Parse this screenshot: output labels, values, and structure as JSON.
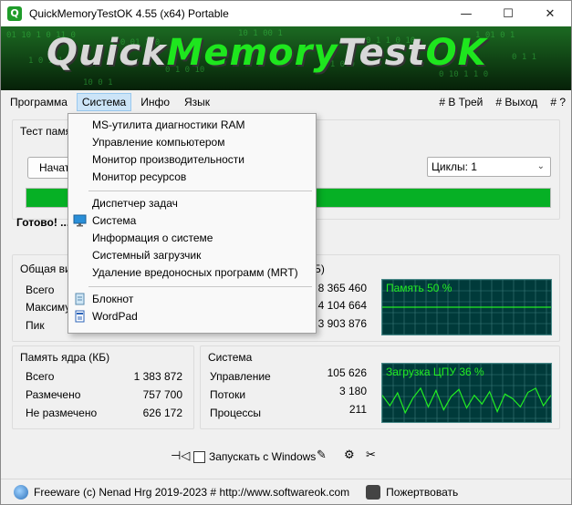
{
  "window": {
    "title": "QuickMemoryTestOK 4.55  (x64) Portable",
    "app_icon_letter": "Q",
    "minimize": "—",
    "maximize": "☐",
    "close": "✕"
  },
  "banner": {
    "part1": "Quick",
    "part2": "Memory",
    "part3": "Test",
    "part4": "OK"
  },
  "menubar": {
    "items": [
      "Программа",
      "Система",
      "Инфо",
      "Язык"
    ],
    "right": [
      "# В Трей",
      "# Выход",
      "# ?"
    ]
  },
  "test_group": {
    "title": "Тест памя",
    "start_button": "Начат",
    "cycles": "Циклы: 1",
    "progress": 1.0,
    "status": "Готово! ..."
  },
  "overall_group": {
    "title": "Общая ви",
    "title_suffix": "Б)",
    "rows": [
      {
        "label": "Всего",
        "value": "8 365 460"
      },
      {
        "label": "Максимум",
        "value": "4 104 664"
      },
      {
        "label": "Пик",
        "value": "3 903 876"
      }
    ],
    "graph_label": "Память 50 %",
    "graph_percent": 50
  },
  "kernel_group": {
    "title": "Память ядра (КБ)",
    "rows": [
      {
        "label": "Всего",
        "value": "1 383 872"
      },
      {
        "label": "Размечено",
        "value": "757 700"
      },
      {
        "label": "Не размечено",
        "value": "626 172"
      }
    ]
  },
  "system_group": {
    "title": "Система",
    "rows": [
      {
        "label": "Управление",
        "value": "105 626"
      },
      {
        "label": "Потоки",
        "value": "3 180"
      },
      {
        "label": "Процессы",
        "value": "211"
      }
    ],
    "graph_label": "Загрузка ЦПУ 36 %",
    "graph_percent": 36
  },
  "autostart": {
    "label": "Запускать с Windows",
    "checked": false
  },
  "footer": {
    "text": "Freeware (c) Nenad Hrg 2019-2023 # http://www.softwareok.com",
    "donate": "Пожертвовать"
  },
  "dropdown": {
    "items": [
      {
        "label": "MS-утилита диагностики RAM",
        "icon": ""
      },
      {
        "label": "Управление компьютером",
        "icon": ""
      },
      {
        "label": "Монитор производительности",
        "icon": ""
      },
      {
        "label": "Монитор ресурсов",
        "icon": ""
      },
      {
        "label": "Диспетчер задач",
        "icon": ""
      },
      {
        "label": "Система",
        "icon": "monitor-icon"
      },
      {
        "label": "Информация о системе",
        "icon": ""
      },
      {
        "label": "Системный загрузчик",
        "icon": ""
      },
      {
        "label": "Удаление вредоносных программ (MRT)",
        "icon": ""
      },
      {
        "label": "Блокнот",
        "icon": "notepad-icon"
      },
      {
        "label": "WordPad",
        "icon": "wordpad-icon"
      }
    ]
  },
  "colors": {
    "accent_green": "#06b025",
    "graph_bg": "#003a3a",
    "graph_line": "#22ee22",
    "menu_highlight": "#cce4f7"
  }
}
